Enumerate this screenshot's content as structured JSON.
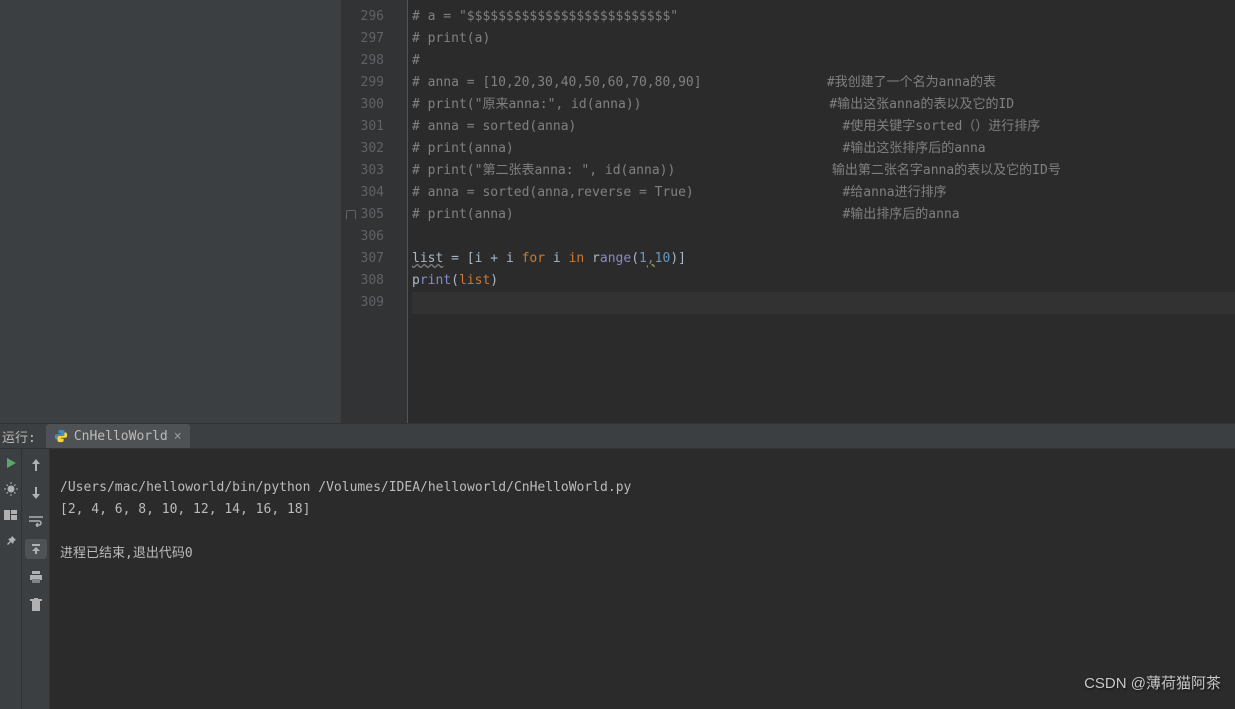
{
  "editor": {
    "lines": [
      {
        "n": 296,
        "html": "<span class='c-comment'># a = \"$$$$$$$$$$$$$$$$$$$$$$$$$$\"</span>"
      },
      {
        "n": 297,
        "html": "<span class='c-comment'># print(a)</span>"
      },
      {
        "n": 298,
        "html": "<span class='c-comment'>#</span>"
      },
      {
        "n": 299,
        "html": "<span class='c-comment'># anna = [10,20,30,40,50,60,70,80,90]</span>                <span class='c-comment'>#我创建了一个名为anna的表</span>"
      },
      {
        "n": 300,
        "html": "<span class='c-comment'># print(\"原来anna:\", id(anna))</span>                        <span class='c-comment'>#输出这张anna的表以及它的ID</span>"
      },
      {
        "n": 301,
        "html": "<span class='c-comment'># anna = sorted(anna)</span>                                  <span class='c-comment'>#使用关键字sorted（）进行排序</span>"
      },
      {
        "n": 302,
        "html": "<span class='c-comment'># print(anna)</span>                                          <span class='c-comment'>#输出这张排序后的anna</span>"
      },
      {
        "n": 303,
        "html": "<span class='c-comment'># print(\"第二张表anna: \", id(anna))</span>                    <span class='c-comment'>输出第二张名字anna的表以及它的ID号</span>"
      },
      {
        "n": 304,
        "html": "<span class='c-comment'># anna = sorted(anna,reverse = True)</span>                   <span class='c-comment'>#给anna进行排序</span>"
      },
      {
        "n": 305,
        "html": "<span class='c-comment'># print(anna)</span>                                          <span class='c-comment'>#输出排序后的anna</span>",
        "lock": true
      },
      {
        "n": 306,
        "html": ""
      },
      {
        "n": 307,
        "html": "<span class='c-warn'>list</span> <span class='c-identifier'>=</span> <span class='c-identifier'>[i</span> <span class='c-identifier'>+</span> <span class='c-identifier'>i</span> <span class='c-keyword'>for</span> <span class='c-identifier'>i</span> <span class='c-keyword'>in</span> <span class='c-identifier'>r</span><span class='c-builtin'>ange</span><span class='c-paren'>(</span><span class='c-number'>1</span><span class='c-comma-warn'>,</span><span class='c-number'>10</span><span class='c-paren'>)]</span>"
      },
      {
        "n": 308,
        "html": "<span class='c-identifier'>p</span><span class='c-builtin'>rint</span><span class='c-paren'>(</span><span class='c-keyword'>list</span><span class='c-paren'>)</span>"
      },
      {
        "n": 309,
        "html": "",
        "cursor": true
      }
    ]
  },
  "run": {
    "label": "运行:",
    "tab_name": "CnHelloWorld"
  },
  "console": {
    "line1": "/Users/mac/helloworld/bin/python /Volumes/IDEA/helloworld/CnHelloWorld.py",
    "line2": "[2, 4, 6, 8, 10, 12, 14, 16, 18]",
    "line3": "",
    "line4": "进程已结束,退出代码0"
  },
  "watermark": "CSDN @薄荷猫阿茶"
}
